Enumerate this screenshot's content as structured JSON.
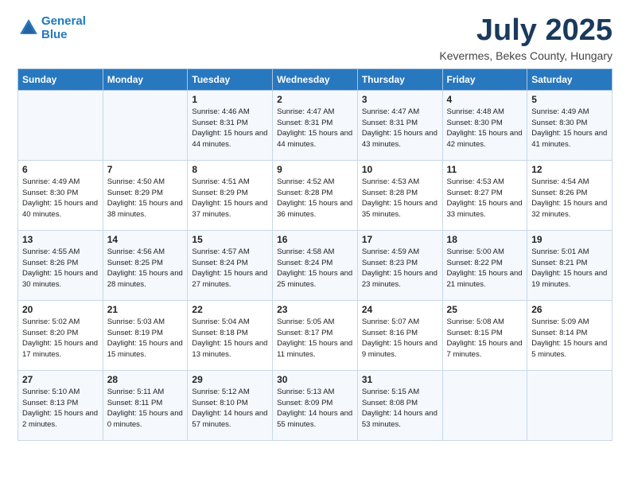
{
  "header": {
    "logo_line1": "General",
    "logo_line2": "Blue",
    "title": "July 2025",
    "location": "Kevermes, Bekes County, Hungary"
  },
  "days_of_week": [
    "Sunday",
    "Monday",
    "Tuesday",
    "Wednesday",
    "Thursday",
    "Friday",
    "Saturday"
  ],
  "weeks": [
    [
      {
        "day": "",
        "info": ""
      },
      {
        "day": "",
        "info": ""
      },
      {
        "day": "1",
        "info": "Sunrise: 4:46 AM\nSunset: 8:31 PM\nDaylight: 15 hours and 44 minutes."
      },
      {
        "day": "2",
        "info": "Sunrise: 4:47 AM\nSunset: 8:31 PM\nDaylight: 15 hours and 44 minutes."
      },
      {
        "day": "3",
        "info": "Sunrise: 4:47 AM\nSunset: 8:31 PM\nDaylight: 15 hours and 43 minutes."
      },
      {
        "day": "4",
        "info": "Sunrise: 4:48 AM\nSunset: 8:30 PM\nDaylight: 15 hours and 42 minutes."
      },
      {
        "day": "5",
        "info": "Sunrise: 4:49 AM\nSunset: 8:30 PM\nDaylight: 15 hours and 41 minutes."
      }
    ],
    [
      {
        "day": "6",
        "info": "Sunrise: 4:49 AM\nSunset: 8:30 PM\nDaylight: 15 hours and 40 minutes."
      },
      {
        "day": "7",
        "info": "Sunrise: 4:50 AM\nSunset: 8:29 PM\nDaylight: 15 hours and 38 minutes."
      },
      {
        "day": "8",
        "info": "Sunrise: 4:51 AM\nSunset: 8:29 PM\nDaylight: 15 hours and 37 minutes."
      },
      {
        "day": "9",
        "info": "Sunrise: 4:52 AM\nSunset: 8:28 PM\nDaylight: 15 hours and 36 minutes."
      },
      {
        "day": "10",
        "info": "Sunrise: 4:53 AM\nSunset: 8:28 PM\nDaylight: 15 hours and 35 minutes."
      },
      {
        "day": "11",
        "info": "Sunrise: 4:53 AM\nSunset: 8:27 PM\nDaylight: 15 hours and 33 minutes."
      },
      {
        "day": "12",
        "info": "Sunrise: 4:54 AM\nSunset: 8:26 PM\nDaylight: 15 hours and 32 minutes."
      }
    ],
    [
      {
        "day": "13",
        "info": "Sunrise: 4:55 AM\nSunset: 8:26 PM\nDaylight: 15 hours and 30 minutes."
      },
      {
        "day": "14",
        "info": "Sunrise: 4:56 AM\nSunset: 8:25 PM\nDaylight: 15 hours and 28 minutes."
      },
      {
        "day": "15",
        "info": "Sunrise: 4:57 AM\nSunset: 8:24 PM\nDaylight: 15 hours and 27 minutes."
      },
      {
        "day": "16",
        "info": "Sunrise: 4:58 AM\nSunset: 8:24 PM\nDaylight: 15 hours and 25 minutes."
      },
      {
        "day": "17",
        "info": "Sunrise: 4:59 AM\nSunset: 8:23 PM\nDaylight: 15 hours and 23 minutes."
      },
      {
        "day": "18",
        "info": "Sunrise: 5:00 AM\nSunset: 8:22 PM\nDaylight: 15 hours and 21 minutes."
      },
      {
        "day": "19",
        "info": "Sunrise: 5:01 AM\nSunset: 8:21 PM\nDaylight: 15 hours and 19 minutes."
      }
    ],
    [
      {
        "day": "20",
        "info": "Sunrise: 5:02 AM\nSunset: 8:20 PM\nDaylight: 15 hours and 17 minutes."
      },
      {
        "day": "21",
        "info": "Sunrise: 5:03 AM\nSunset: 8:19 PM\nDaylight: 15 hours and 15 minutes."
      },
      {
        "day": "22",
        "info": "Sunrise: 5:04 AM\nSunset: 8:18 PM\nDaylight: 15 hours and 13 minutes."
      },
      {
        "day": "23",
        "info": "Sunrise: 5:05 AM\nSunset: 8:17 PM\nDaylight: 15 hours and 11 minutes."
      },
      {
        "day": "24",
        "info": "Sunrise: 5:07 AM\nSunset: 8:16 PM\nDaylight: 15 hours and 9 minutes."
      },
      {
        "day": "25",
        "info": "Sunrise: 5:08 AM\nSunset: 8:15 PM\nDaylight: 15 hours and 7 minutes."
      },
      {
        "day": "26",
        "info": "Sunrise: 5:09 AM\nSunset: 8:14 PM\nDaylight: 15 hours and 5 minutes."
      }
    ],
    [
      {
        "day": "27",
        "info": "Sunrise: 5:10 AM\nSunset: 8:13 PM\nDaylight: 15 hours and 2 minutes."
      },
      {
        "day": "28",
        "info": "Sunrise: 5:11 AM\nSunset: 8:11 PM\nDaylight: 15 hours and 0 minutes."
      },
      {
        "day": "29",
        "info": "Sunrise: 5:12 AM\nSunset: 8:10 PM\nDaylight: 14 hours and 57 minutes."
      },
      {
        "day": "30",
        "info": "Sunrise: 5:13 AM\nSunset: 8:09 PM\nDaylight: 14 hours and 55 minutes."
      },
      {
        "day": "31",
        "info": "Sunrise: 5:15 AM\nSunset: 8:08 PM\nDaylight: 14 hours and 53 minutes."
      },
      {
        "day": "",
        "info": ""
      },
      {
        "day": "",
        "info": ""
      }
    ]
  ]
}
